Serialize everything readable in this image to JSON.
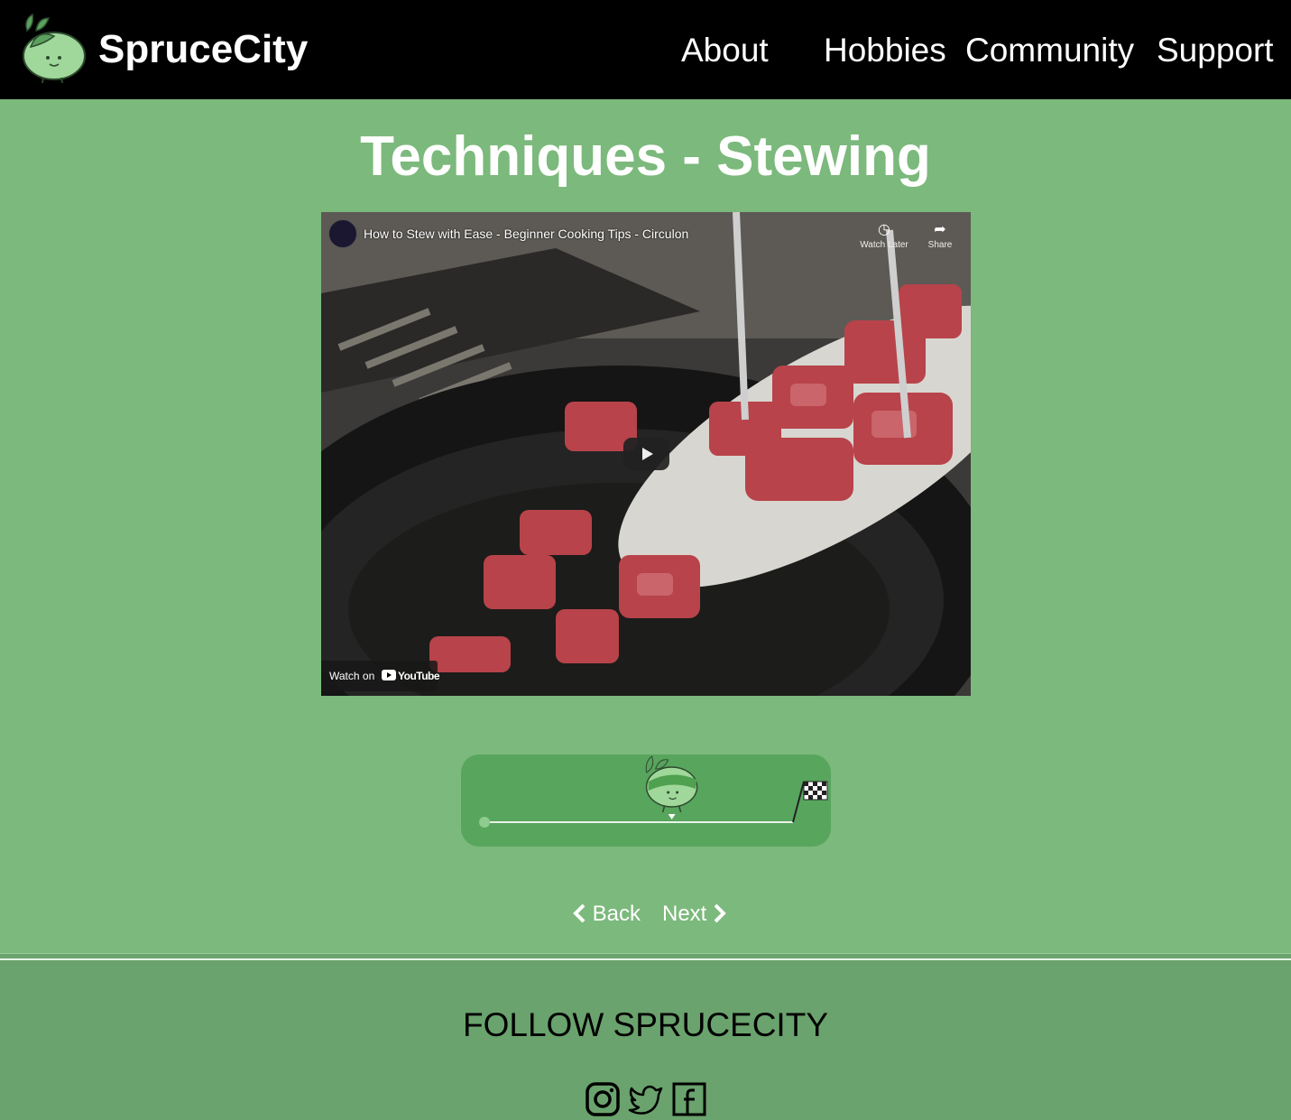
{
  "header": {
    "brand": "SpruceCity",
    "nav": [
      {
        "label": "About"
      },
      {
        "label": "Hobbies"
      },
      {
        "label": "Community"
      },
      {
        "label": "Support"
      }
    ]
  },
  "main": {
    "title": "Techniques - Stewing",
    "video": {
      "title": "How to Stew with Ease - Beginner Cooking Tips - Circulon",
      "watch_later": "Watch Later",
      "share": "Share",
      "watch_on": "Watch on",
      "youtube": "YouTube"
    },
    "progress": {
      "value": 0.6
    },
    "pager": {
      "back": "Back",
      "next": "Next"
    }
  },
  "footer": {
    "follow": "FOLLOW SPRUCECITY",
    "social": [
      "instagram-icon",
      "twitter-icon",
      "facebook-icon"
    ]
  },
  "colors": {
    "background": "#7cb97c",
    "header": "#000000",
    "footer": "#6aa36d",
    "progress_track": "#58a55e"
  }
}
